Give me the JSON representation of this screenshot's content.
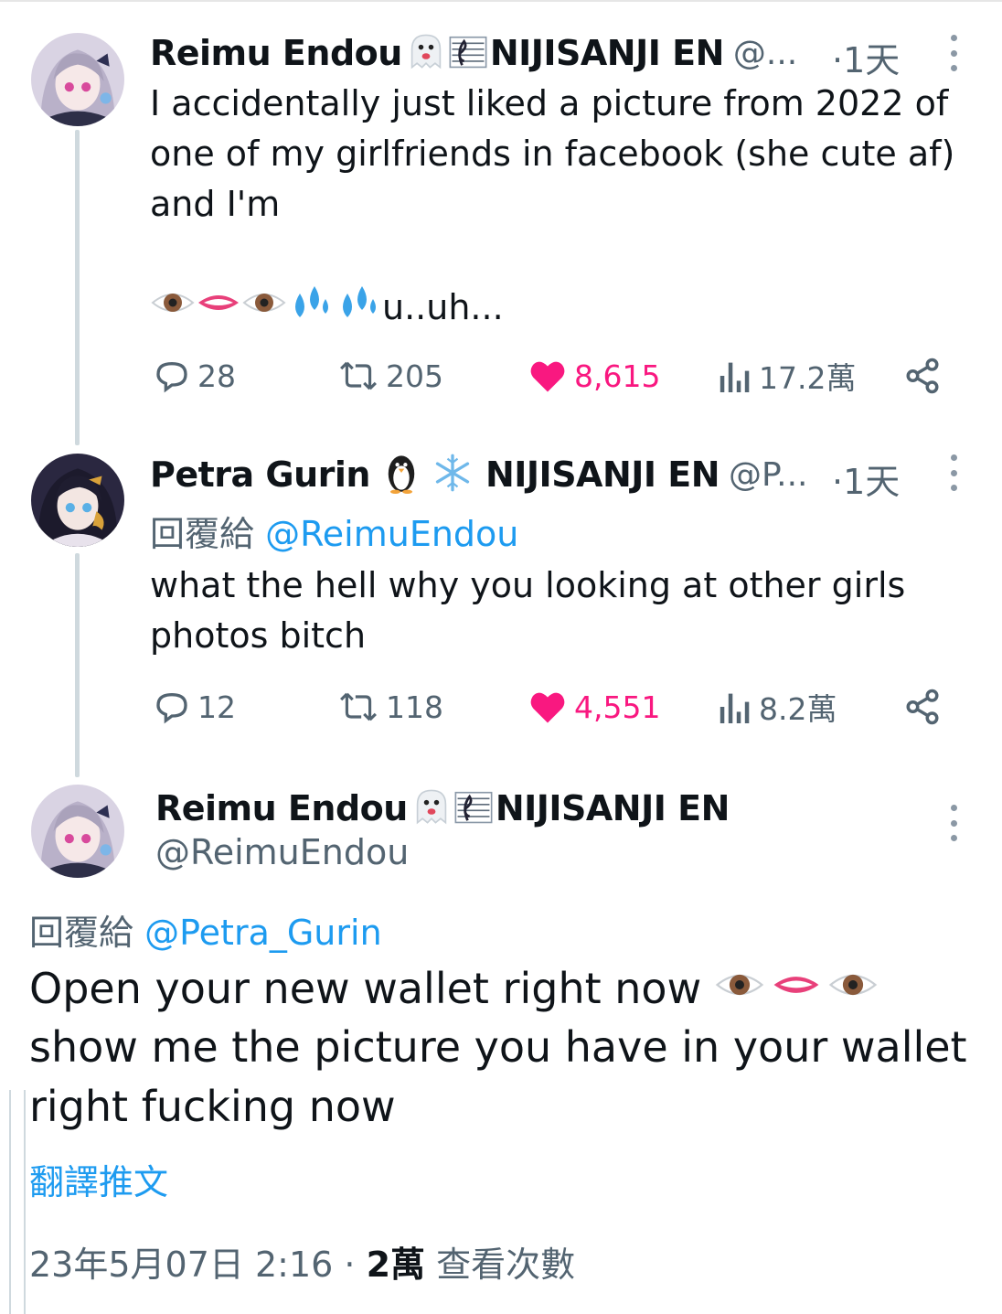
{
  "tweets": [
    {
      "name": "Reimu Endou",
      "name_suffix": "NIJISANJI EN",
      "handle": "@...",
      "time": "·1天",
      "text": "I accidentally just liked a picture from 2022 of\none of my girlfriends in facebook (she cute af)\nand I'm",
      "emoji_line_text": "u..uh...",
      "stats": {
        "replies": "28",
        "retweets": "205",
        "likes": "8,615",
        "views": "17.2萬"
      }
    },
    {
      "name": "Petra Gurin",
      "name_suffix": "NIJISANJI EN",
      "handle": "@P...",
      "time": "·1天",
      "reply_prefix": "回覆給",
      "reply_handle": "@ReimuEndou",
      "text": "what the hell why you looking at other girls\nphotos bitch",
      "stats": {
        "replies": "12",
        "retweets": "118",
        "likes": "4,551",
        "views": "8.2萬"
      }
    },
    {
      "name": "Reimu Endou",
      "name_suffix": "NIJISANJI EN",
      "handle": "@ReimuEndou",
      "reply_prefix": "回覆給",
      "reply_handle": "@Petra_Gurin",
      "text_line1": "Open your new wallet right now",
      "text_rest": "show me the picture you have in your wallet\nright fucking now",
      "translate": "翻譯推文",
      "timestamp": "23年5月07日 2:16",
      "separator": "·",
      "views_count": "2萬",
      "views_label": "查看次數"
    }
  ],
  "colors": {
    "like": "#f91880",
    "link": "#1d9bf0",
    "secondary": "#536471"
  },
  "icons": [
    "reply-icon",
    "retweet-icon",
    "heart-icon",
    "views-icon",
    "share-icon",
    "more-icon"
  ]
}
